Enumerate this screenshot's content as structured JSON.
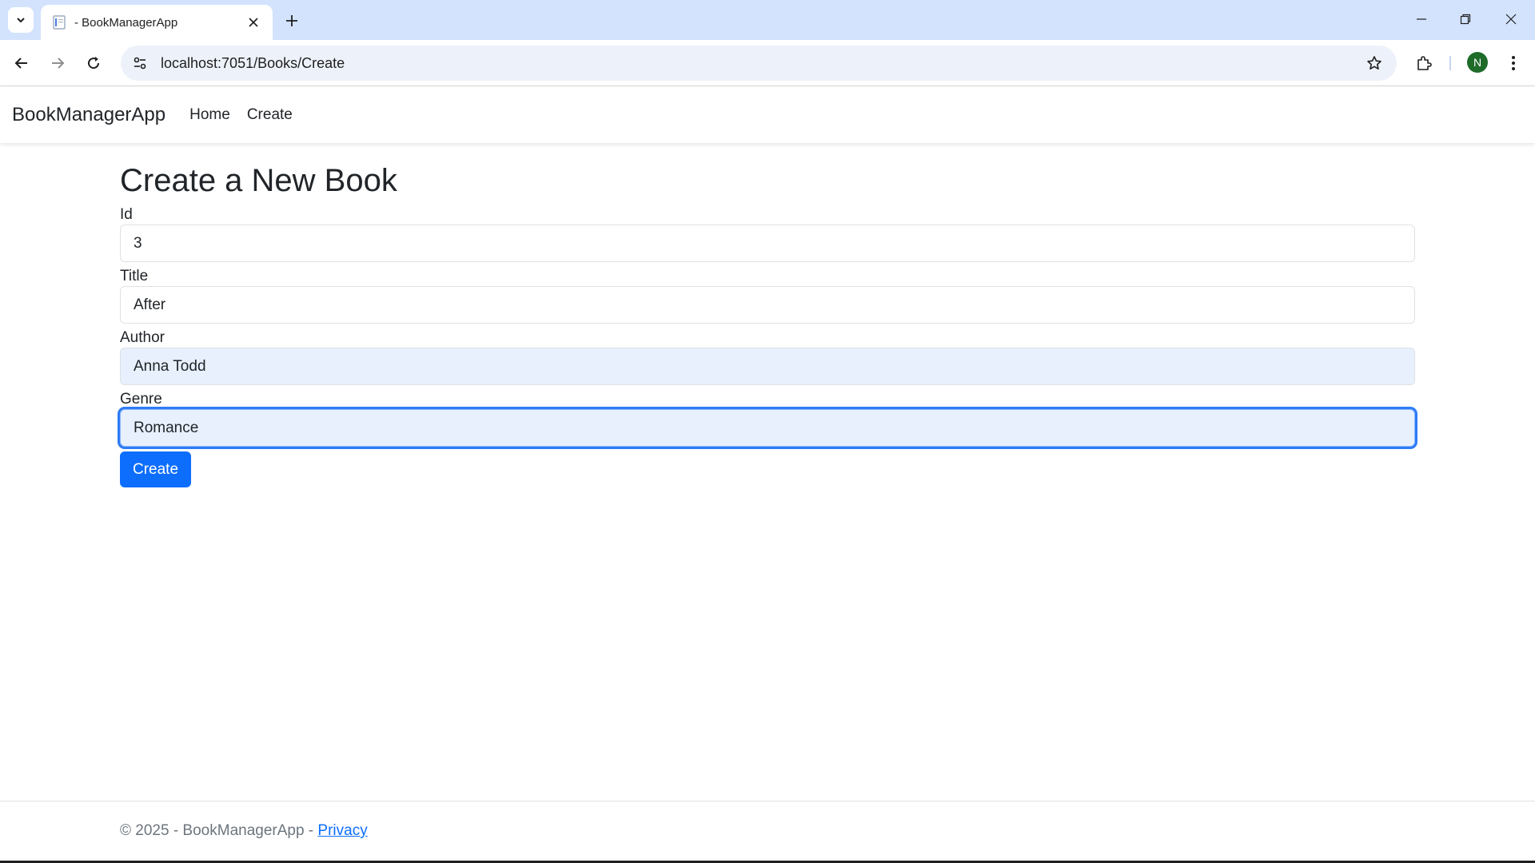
{
  "browser": {
    "tab_title": "- BookManagerApp",
    "url": "localhost:7051/Books/Create",
    "profile_initial": "N"
  },
  "navbar": {
    "brand": "BookManagerApp",
    "links": [
      "Home",
      "Create"
    ]
  },
  "page": {
    "heading": "Create a New Book",
    "fields": [
      {
        "label": "Id",
        "value": "3"
      },
      {
        "label": "Title",
        "value": "After"
      },
      {
        "label": "Author",
        "value": "Anna Todd"
      },
      {
        "label": "Genre",
        "value": "Romance"
      }
    ],
    "submit_label": "Create"
  },
  "footer": {
    "text": "© 2025 - BookManagerApp - ",
    "privacy_link": "Privacy"
  },
  "colors": {
    "primary": "#0d6efd",
    "tabbar": "#d3e3fd",
    "autofill": "#e8f0fe",
    "avatar": "#1e6b2a"
  }
}
